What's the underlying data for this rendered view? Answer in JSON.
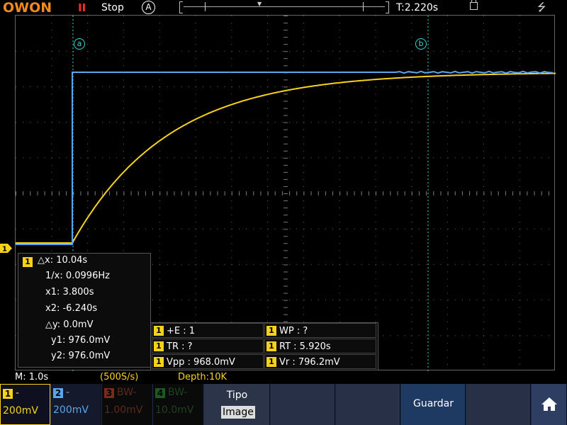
{
  "topbar": {
    "logo": "OWON",
    "run_state": "Stop",
    "acquire_mode": "A",
    "trigger_time": "T:2.220s"
  },
  "cursors": {
    "a_label": "a",
    "b_label": "b"
  },
  "trigger": {
    "channel_marker": "1"
  },
  "measure": {
    "channel": "1",
    "dx": "△x: 10.04s",
    "inv_dx": "1/x: 0.0996Hz",
    "x1": "x1: 3.800s",
    "x2": "x2: -6.240s",
    "dy": "△y: 0.0mV",
    "y1": "y1: 976.0mV",
    "y2": "y2: 976.0mV"
  },
  "auto_measure": [
    {
      "channel": "1",
      "text": "+E : 1"
    },
    {
      "channel": "1",
      "text": "WP :    ?"
    },
    {
      "channel": "1",
      "text": "TR :     ?"
    },
    {
      "channel": "1",
      "text": "RT : 5.920s"
    },
    {
      "channel": "1",
      "text": "Vpp : 968.0mV"
    },
    {
      "channel": "1",
      "text": "Vr : 796.2mV"
    }
  ],
  "status": {
    "timebase": "M: 1.0s",
    "sample_rate": "(500S/s)",
    "depth": "Depth:10K"
  },
  "bottom": {
    "ch1": {
      "num": "1",
      "dash": "-",
      "value": "200mV"
    },
    "ch2": {
      "num": "2",
      "dash": "-",
      "value": "200mV"
    },
    "ch3": {
      "num": "3",
      "dash": "BW-",
      "value": "1.00mV"
    },
    "ch4": {
      "num": "4",
      "dash": "BW-",
      "value": "10.0mV"
    },
    "tipo_label": "Tipo",
    "tipo_value": "Image",
    "guardar": "Guardar"
  },
  "colors": {
    "ch1": "#f7d21b",
    "ch2": "#5aa6ee",
    "cursor": "#38d6d6",
    "logo": "#f08a1c",
    "stop": "#ff2a2a"
  },
  "icons": {
    "lock": "lock-icon",
    "usb": "usb-icon",
    "home": "home-icon"
  }
}
